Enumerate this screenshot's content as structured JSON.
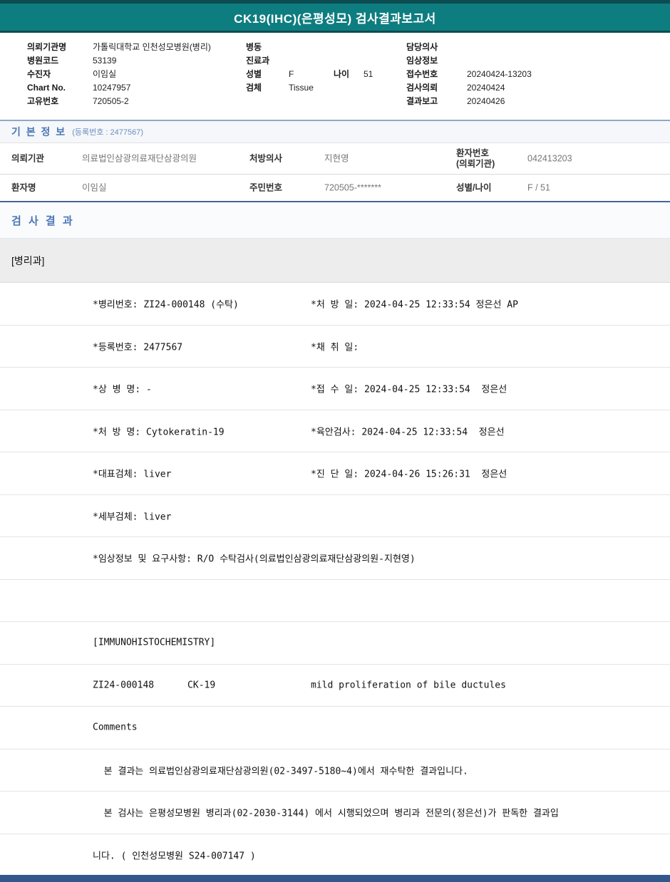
{
  "page": {
    "title": "CK19(IHC)(은평성모) 검사결과보고서"
  },
  "colors": {
    "header_teal": "#0e7d80",
    "header_teal_dark": "#0b4c50",
    "section_blue": "#4a77b4",
    "footer_navy": "#33568c"
  },
  "patient_header": {
    "col1": [
      {
        "label": "의뢰기관명",
        "value": "가톨릭대학교 인천성모병원(병리)"
      },
      {
        "label": "병원코드",
        "value": "53139"
      },
      {
        "label": "수진자",
        "value": "이임실"
      },
      {
        "label": "Chart No.",
        "value": "10247957"
      },
      {
        "label": "고유번호",
        "value": "720505-2"
      }
    ],
    "col2": [
      {
        "label": "병동",
        "value": ""
      },
      {
        "label": "진료과",
        "value": ""
      },
      {
        "label": "성별",
        "value": "F",
        "label2": "나이",
        "value2": "51"
      },
      {
        "label": "검체",
        "value": "Tissue"
      }
    ],
    "col3": [
      {
        "label": "담당의사",
        "value": ""
      },
      {
        "label": "임상정보",
        "value": ""
      },
      {
        "label": "접수번호",
        "value": "20240424-13203"
      },
      {
        "label": "검사의뢰",
        "value": "20240424"
      },
      {
        "label": "결과보고",
        "value": "20240426"
      }
    ]
  },
  "basic_info": {
    "section_title": "기 본 정 보",
    "section_subtitle": "(등록번호 : 2477567)",
    "row1": {
      "l1": "의뢰기관",
      "v1": "의료법인삼광의료재단삼광의원",
      "l2": "처방의사",
      "v2": "지현영",
      "l3": "환자번호\n(의뢰기관)",
      "v3": "042413203"
    },
    "row2": {
      "l1": "환자명",
      "v1": "이임실",
      "l2": "주민번호",
      "v2": "720505-*******",
      "l3": "성별/나이",
      "v3": "F / 51"
    }
  },
  "results": {
    "section_title": "검 사 결 과",
    "department": "[병리과]",
    "rows": [
      {
        "left": "*병리번호: ZI24-000148 (수탁)",
        "right": "*처 방 일: 2024-04-25 12:33:54 정은선 AP"
      },
      {
        "left": "*등록번호: 2477567",
        "right": "*채 취 일:"
      },
      {
        "left": "*상 병 명: -",
        "right": "*접 수 일: 2024-04-25 12:33:54  정은선"
      },
      {
        "left": "*처 방 명: Cytokeratin-19",
        "right": "*육안검사: 2024-04-25 12:33:54  정은선"
      },
      {
        "left": "*대표검체: liver",
        "right": "*진 단 일: 2024-04-26 15:26:31  정은선"
      },
      {
        "left": "*세부검체: liver",
        "right": ""
      },
      {
        "left": "*임상정보 및 요구사항: R/O 수탁검사(의료법인삼광의료재단삼광의원-지현영)",
        "right": ""
      },
      {
        "left": "",
        "right": ""
      },
      {
        "left": "[IMMUNOHISTOCHEMISTRY]",
        "right": ""
      },
      {
        "left": "ZI24-000148      CK-19",
        "right": "mild proliferation of bile ductules"
      },
      {
        "left": "Comments",
        "right": ""
      },
      {
        "left": "  본 결과는 의료법인삼광의료재단삼광의원(02-3497-5180~4)에서 재수탁한 결과입니다.",
        "right": ""
      },
      {
        "left": "  본 검사는 은평성모병원 병리과(02-2030-3144) 에서 시행되었으며 병리과 전문의(정은선)가 판독한 결과입",
        "right": ""
      },
      {
        "left": "니다. ( 인천성모병원 S24-007147 )",
        "right": ""
      }
    ]
  }
}
